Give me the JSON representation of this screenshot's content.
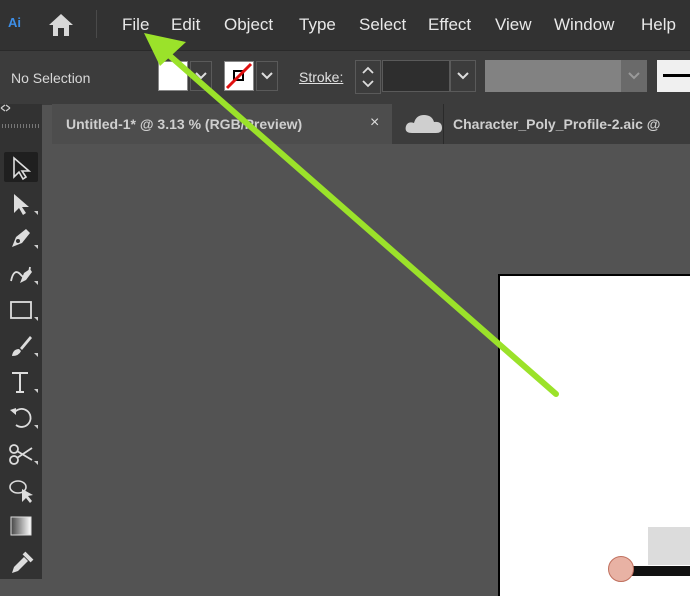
{
  "app": {
    "logo": "Ai"
  },
  "menu": [
    "File",
    "Edit",
    "Object",
    "Type",
    "Select",
    "Effect",
    "View",
    "Window",
    "Help"
  ],
  "control": {
    "selection_label": "No Selection",
    "stroke_label": "Stroke:",
    "stroke_value": ""
  },
  "tabs": [
    {
      "title": "Untitled-1* @ 3.13 % (RGB/Preview)",
      "close": "×"
    },
    {
      "title": "Character_Poly_Profile-2.aic @"
    }
  ],
  "colors": {
    "arrow": "#9be22a",
    "accent": "#3d8ee6"
  },
  "icons": [
    "home-icon",
    "selection-tool-icon",
    "direct-selection-tool-icon",
    "pen-tool-icon",
    "curvature-tool-icon",
    "rectangle-tool-icon",
    "paintbrush-tool-icon",
    "type-tool-icon",
    "rotate-tool-icon",
    "scissors-tool-icon",
    "shape-builder-tool-icon",
    "gradient-tool-icon",
    "eyedropper-tool-icon",
    "cloud-icon"
  ]
}
